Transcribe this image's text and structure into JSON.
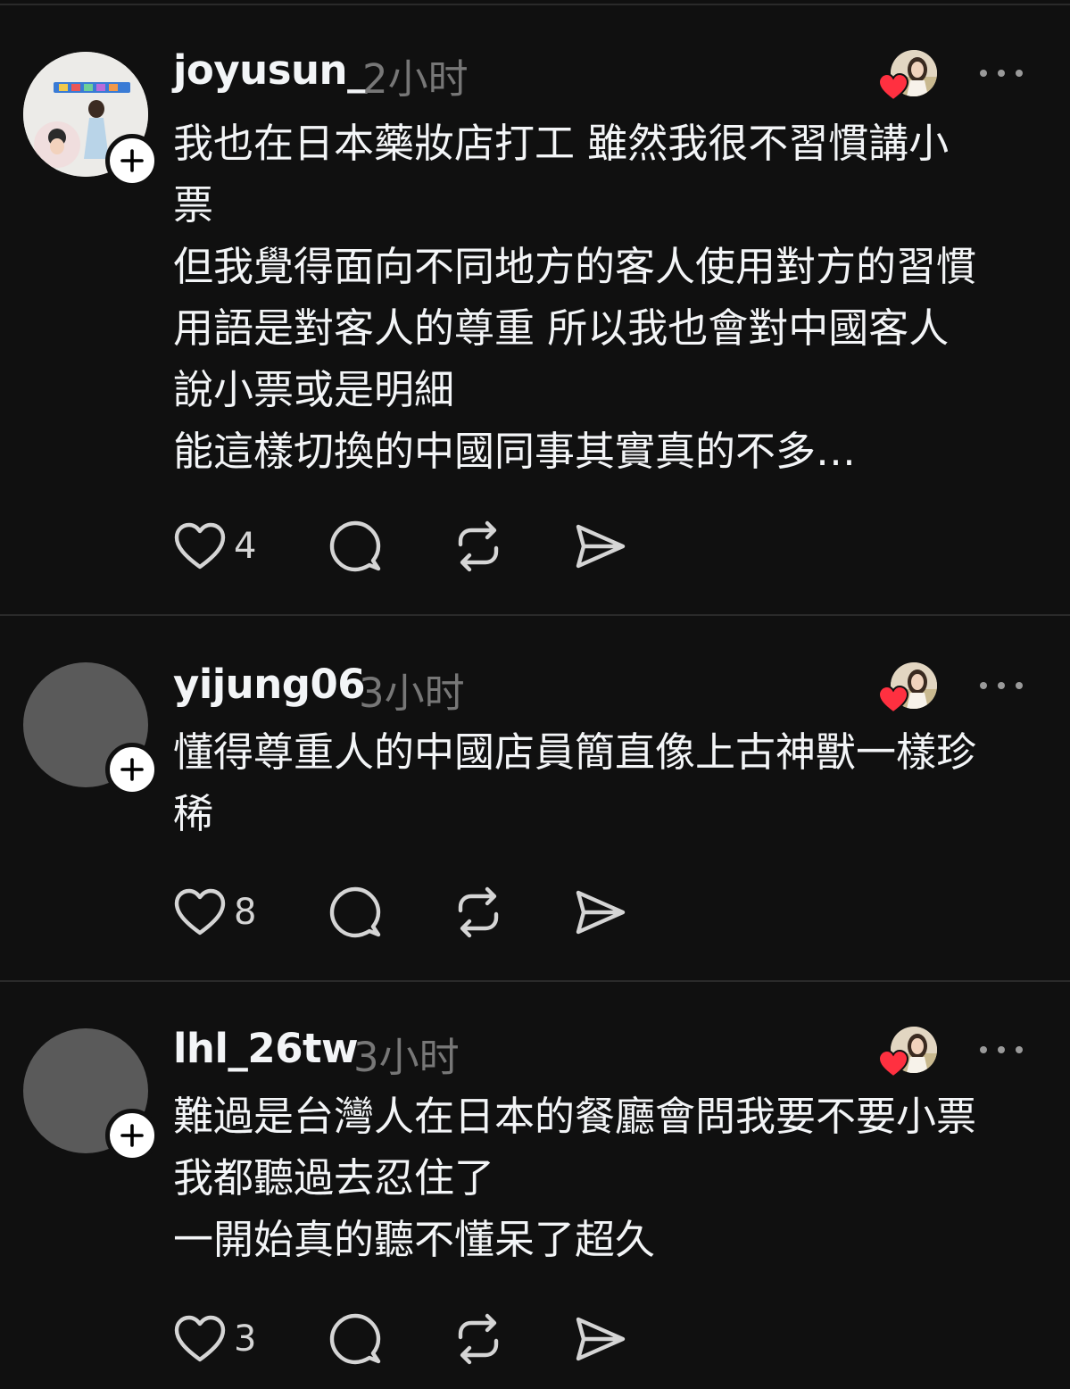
{
  "posts": [
    {
      "username": "joyusun_",
      "time": "2小时",
      "lines": [
        "我也在日本藥妝店打工 雖然我很不習慣講小",
        "票",
        "但我覺得面向不同地方的客人使用對方的習慣",
        "用語是對客人的尊重 所以我也會對中國客人",
        "說小票或是明細",
        "能這樣切換的中國同事其實真的不多…"
      ],
      "likes": "4"
    },
    {
      "username": "yijung06",
      "time": "3小时",
      "lines": [
        "懂得尊重人的中國店員簡直像上古神獸一樣珍",
        "稀"
      ],
      "likes": "8"
    },
    {
      "username": "lhl_26tw",
      "time": "3小时",
      "lines": [
        "難過是台灣人在日本的餐廳會問我要不要小票",
        "我都聽過去忍住了",
        "一開始真的聽不懂呆了超久"
      ],
      "likes": "3"
    }
  ],
  "icons": {
    "like": "heart-outline-icon",
    "comment": "speech-bubble-icon",
    "repost": "repost-arrows-icon",
    "share": "paper-plane-icon",
    "follow": "plus-icon",
    "more": "more-dots-icon",
    "liked_badge": "red-heart-icon"
  },
  "colors": {
    "background": "#101010",
    "text": "#f3f5f7",
    "muted": "#777777",
    "heart": "#ff3040"
  }
}
